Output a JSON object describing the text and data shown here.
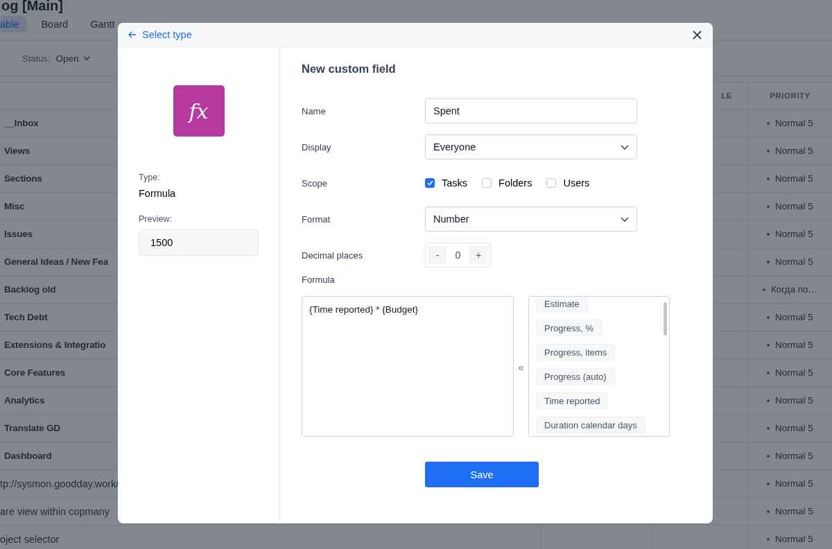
{
  "page": {
    "title": "og [Main]",
    "tabs": [
      {
        "label": "able",
        "selected": true
      },
      {
        "label": "Board",
        "selected": false
      },
      {
        "label": "Gantt",
        "selected": false
      }
    ],
    "filter": {
      "label": "Status:",
      "value": "Open"
    },
    "table": {
      "columns": [
        "LE",
        "PRIORITY"
      ],
      "rows": [
        {
          "kind": "group",
          "name": "__Inbox",
          "priority": "Normal 5"
        },
        {
          "kind": "group",
          "name": "Views",
          "priority": "Normal 5"
        },
        {
          "kind": "group",
          "name": "Sections",
          "priority": "Normal 5"
        },
        {
          "kind": "group",
          "name": "Misc",
          "priority": "Normal 5"
        },
        {
          "kind": "group",
          "name": "Issues",
          "priority": "Normal 5"
        },
        {
          "kind": "group",
          "name": "General Ideas / New Fea",
          "priority": "Normal 5"
        },
        {
          "kind": "group",
          "name": "Backlog old",
          "priority": "Когда по…"
        },
        {
          "kind": "group",
          "name": "Tech Debt",
          "priority": "Normal 5"
        },
        {
          "kind": "group",
          "name": "Extensions & Integratio",
          "priority": "Normal 5"
        },
        {
          "kind": "group",
          "name": "Core Features",
          "priority": "Normal 5"
        },
        {
          "kind": "group",
          "name": "Analytics",
          "priority": "Normal 5"
        },
        {
          "kind": "group",
          "name": "Translate GD",
          "priority": "Normal 5"
        },
        {
          "kind": "group",
          "name": "Dashboard",
          "priority": "Normal 5"
        },
        {
          "kind": "task",
          "name": "tp://sysmon.goodday.work/",
          "priority": "Normal 5"
        },
        {
          "kind": "task",
          "name": "are view within copmany",
          "priority": "Normal 5"
        },
        {
          "kind": "task",
          "name": "oject selector",
          "priority": "Normal 5"
        }
      ]
    }
  },
  "dialog": {
    "back_link": "Select type",
    "icon_text": "fx",
    "type_label": "Type:",
    "type_value": "Formula",
    "preview_label": "Preview:",
    "preview_value": "1500",
    "title": "New custom field",
    "fields": [
      {
        "kind": "text",
        "label": "Name",
        "value": "Spent"
      },
      {
        "kind": "select",
        "label": "Display",
        "value": "Everyone"
      },
      {
        "kind": "checks",
        "label": "Scope",
        "options": [
          {
            "label": "Tasks",
            "checked": true
          },
          {
            "label": "Folders",
            "checked": false
          },
          {
            "label": "Users",
            "checked": false
          }
        ]
      },
      {
        "kind": "select",
        "label": "Format",
        "value": "Number"
      },
      {
        "kind": "stepper",
        "label": "Decimal places",
        "minus": "-",
        "value": "0",
        "plus": "+"
      }
    ],
    "formula": {
      "label": "Formula",
      "value": "{Time reported} * {Budget}",
      "insert": "«",
      "tokens": [
        "Estimate",
        "Progress, %",
        "Progress, items",
        "Progress (auto)",
        "Time reported",
        "Duration calendar days"
      ]
    },
    "save": "Save"
  }
}
